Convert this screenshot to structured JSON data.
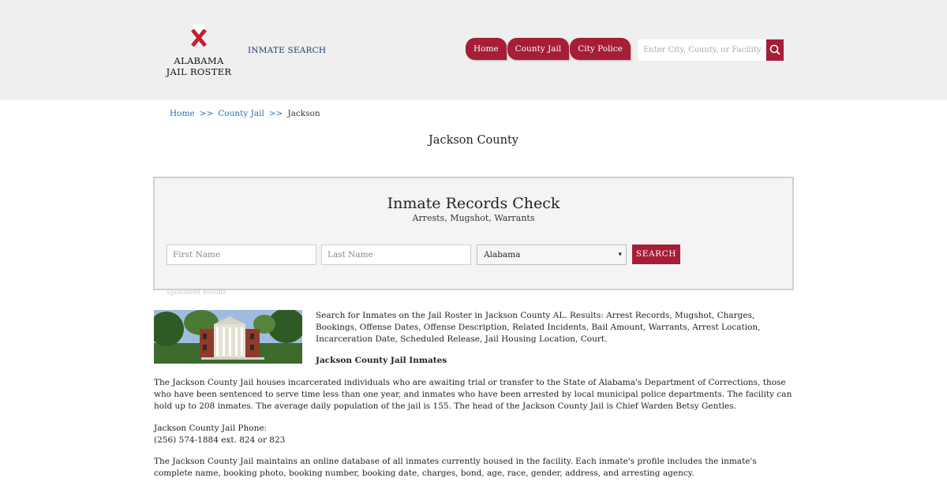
{
  "header": {
    "logo_line1": "ALABAMA",
    "logo_line2": "JAIL ROSTER",
    "inmate_search_link": "INMATE SEARCH",
    "nav": [
      "Home",
      "County Jail",
      "City Police"
    ],
    "search_placeholder": "Enter City, County, or Facility",
    "brand_color": "#a51d36"
  },
  "breadcrumb": {
    "home": "Home",
    "sep1": ">>",
    "county_jail": "County Jail",
    "sep2": ">>",
    "current": "Jackson"
  },
  "page_title": "Jackson County",
  "records_check": {
    "title": "Inmate Records Check",
    "subtitle": "Arrests, Mugshot, Warrants",
    "first_name_placeholder": "First Name",
    "last_name_placeholder": "Last Name",
    "state_selected": "Alabama",
    "search_button": "SEARCH",
    "sponsored": "Sponsored Results"
  },
  "content": {
    "intro": "Search for Inmates on the Jail Roster in Jackson County AL. Results: Arrest Records, Mugshot, Charges, Bookings, Offense Dates, Offense Description, Related Incidents, Bail Amount, Warrants, Arrest Location, Incarceration Date, Scheduled Release, Jail Housing Location, Court.",
    "subhead": "Jackson County Jail Inmates",
    "para1": "The Jackson County Jail houses incarcerated individuals who are awaiting trial or transfer to the State of Alabama's Department of Corrections, those who have been sentenced to serve time less than one year, and inmates who have been arrested by local municipal police departments. The facility can hold up to 208 inmates. The average daily population of the jail is 155. The head of the Jackson County Jail is Chief Warden Betsy Gentles.",
    "phone_label": "Jackson County Jail Phone:",
    "phone_value": "(256) 574-1884 ext. 824 or 823",
    "para2": "The Jackson County Jail maintains an online database of all inmates currently housed in the facility. Each inmate's profile includes the inmate's complete name, booking photo, booking number, booking date, charges, bond, age, race, gender, address, and arresting agency."
  }
}
